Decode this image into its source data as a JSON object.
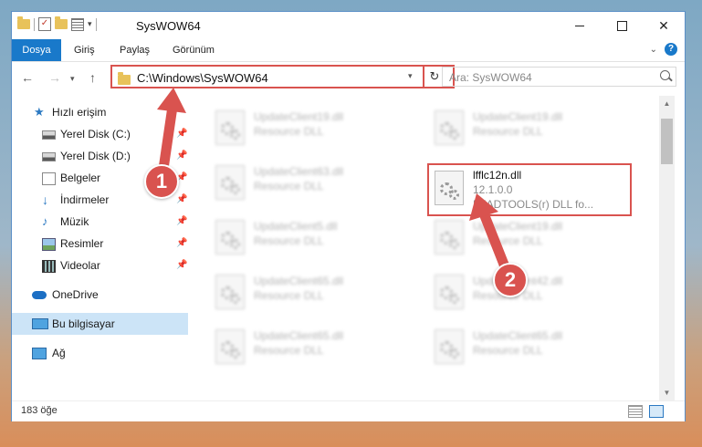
{
  "window": {
    "title": "SysWOW64",
    "controls": {
      "minimize": "",
      "maximize": "",
      "close": "✕"
    }
  },
  "ribbon": {
    "tabs": [
      {
        "label": "Dosya",
        "active": true
      },
      {
        "label": "Giriş"
      },
      {
        "label": "Paylaş"
      },
      {
        "label": "Görünüm"
      }
    ],
    "help": "?"
  },
  "nav": {
    "address": "C:\\Windows\\SysWOW64",
    "search_placeholder": "Ara: SysWOW64"
  },
  "sidebar": {
    "items": [
      {
        "label": "Hızlı erişim",
        "icon": "star-icon"
      },
      {
        "label": "Yerel Disk (C:)",
        "icon": "disk-icon",
        "pinned": true
      },
      {
        "label": "Yerel Disk (D:)",
        "icon": "disk-icon",
        "pinned": true
      },
      {
        "label": "Belgeler",
        "icon": "documents-icon",
        "pinned": true
      },
      {
        "label": "İndirmeler",
        "icon": "downloads-icon",
        "pinned": true
      },
      {
        "label": "Müzik",
        "icon": "music-icon",
        "pinned": true
      },
      {
        "label": "Resimler",
        "icon": "pictures-icon",
        "pinned": true
      },
      {
        "label": "Videolar",
        "icon": "videos-icon",
        "pinned": true
      },
      {
        "label": "OneDrive",
        "icon": "onedrive-icon"
      },
      {
        "label": "Bu bilgisayar",
        "icon": "pc-icon",
        "selected": true
      },
      {
        "label": "Ağ",
        "icon": "network-icon"
      }
    ]
  },
  "files": {
    "left": [
      {
        "name": "UpdateClient19.dll",
        "desc": "Resource DLL"
      },
      {
        "name": "UpdateClient63.dll",
        "desc": "Resource DLL"
      },
      {
        "name": "UpdateClient5.dll",
        "desc": "Resource DLL"
      },
      {
        "name": "UpdateClient65.dll",
        "desc": "Resource DLL"
      },
      {
        "name": "UpdateClient65.dll",
        "desc": "Resource DLL"
      }
    ],
    "right": [
      {
        "name": "UpdateClient19.dll",
        "desc": "Resource DLL"
      },
      {
        "name": "UpdateClient19.dll",
        "desc": "Resource DLL"
      },
      {
        "name": "UpdateClient42.dll",
        "desc": "Resource DLL"
      },
      {
        "name": "UpdateClient65.dll",
        "desc": "Resource DLL"
      }
    ],
    "target": {
      "name": "lfflc12n.dll",
      "version": "12.1.0.0",
      "desc": "LEADTOOLS(r) DLL fo..."
    }
  },
  "status": {
    "count": "183 öğe"
  },
  "annotations": {
    "step1": "1",
    "step2": "2",
    "accent": "#d9534f"
  }
}
